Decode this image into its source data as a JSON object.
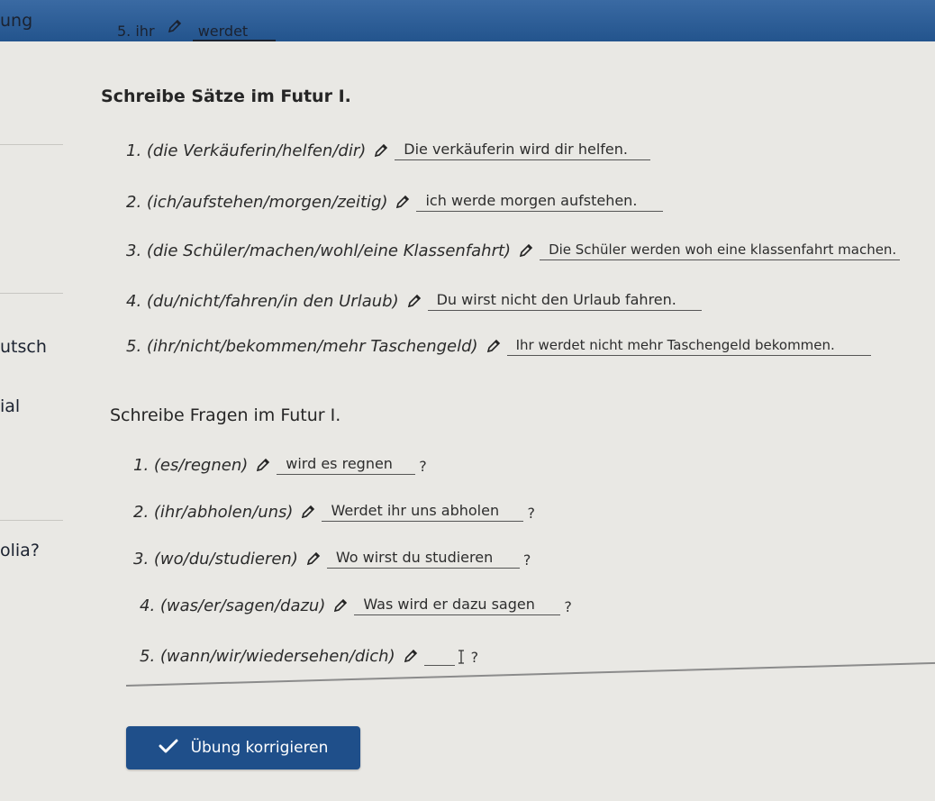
{
  "top_bar": {
    "left_fragment": "ung",
    "hint_prompt": "5. ihr",
    "hint_answer": "werdet"
  },
  "left_fragments": [
    "utsch",
    "ial",
    "olia?"
  ],
  "section1": {
    "title": "Schreibe Sätze im Futur I.",
    "items": [
      {
        "prompt": "1. (die Verkäuferin/helfen/dir)",
        "answer": "Die verkäuferin wird dir helfen."
      },
      {
        "prompt": "2. (ich/aufstehen/morgen/zeitig)",
        "answer": "ich werde morgen aufstehen."
      },
      {
        "prompt": "3. (die Schüler/machen/wohl/eine Klassenfahrt)",
        "answer": "Die Schüler werden woh eine klassenfahrt machen."
      },
      {
        "prompt": "4. (du/nicht/fahren/in den Urlaub)",
        "answer": "Du wirst nicht den Urlaub fahren."
      },
      {
        "prompt": "5. (ihr/nicht/bekommen/mehr Taschengeld)",
        "answer": "Ihr werdet nicht mehr Taschengeld bekommen."
      }
    ]
  },
  "section2": {
    "title": "Schreibe Fragen im Futur I.",
    "items": [
      {
        "prompt": "1. (es/regnen)",
        "answer": "wird es regnen",
        "suffix": "?"
      },
      {
        "prompt": "2. (ihr/abholen/uns)",
        "answer": "Werdet ihr uns abholen",
        "suffix": "?"
      },
      {
        "prompt": "3. (wo/du/studieren)",
        "answer": "Wo wirst du studieren",
        "suffix": "?"
      },
      {
        "prompt": "4. (was/er/sagen/dazu)",
        "answer": "Was wird er dazu sagen",
        "suffix": "?"
      },
      {
        "prompt": "5. (wann/wir/wiedersehen/dich)",
        "answer": "",
        "suffix": "?"
      }
    ]
  },
  "correct_button": {
    "label": "Übung korrigieren",
    "icon": "checkmark-icon"
  },
  "colors": {
    "top_bar": "#23548d",
    "button": "#1f4f8a",
    "background": "#e9e8e4"
  }
}
